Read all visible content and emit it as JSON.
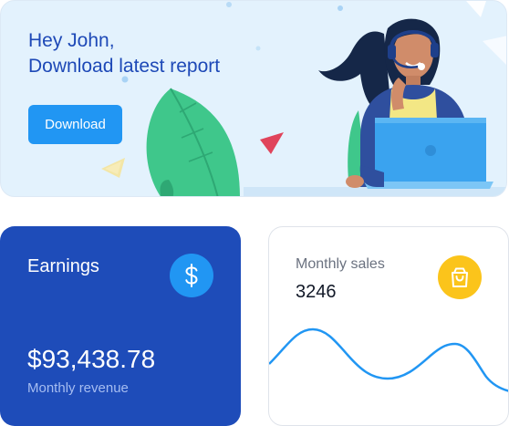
{
  "banner": {
    "greeting_line1": "Hey John,",
    "greeting_line2": "Download latest report",
    "download_label": "Download",
    "colors": {
      "background": "#e3f2fd",
      "text": "#1e49b7",
      "button": "#2196f3"
    }
  },
  "earnings": {
    "title": "Earnings",
    "amount": "$93,438.78",
    "subtitle": "Monthly revenue",
    "icon": "dollar-icon",
    "colors": {
      "background": "#1e4cb9",
      "badge": "#2196f3"
    }
  },
  "sales": {
    "title": "Monthly sales",
    "value": "3246",
    "icon": "shopping-bag-icon",
    "colors": {
      "badge": "#fbc41b",
      "line": "#2196f3"
    }
  }
}
